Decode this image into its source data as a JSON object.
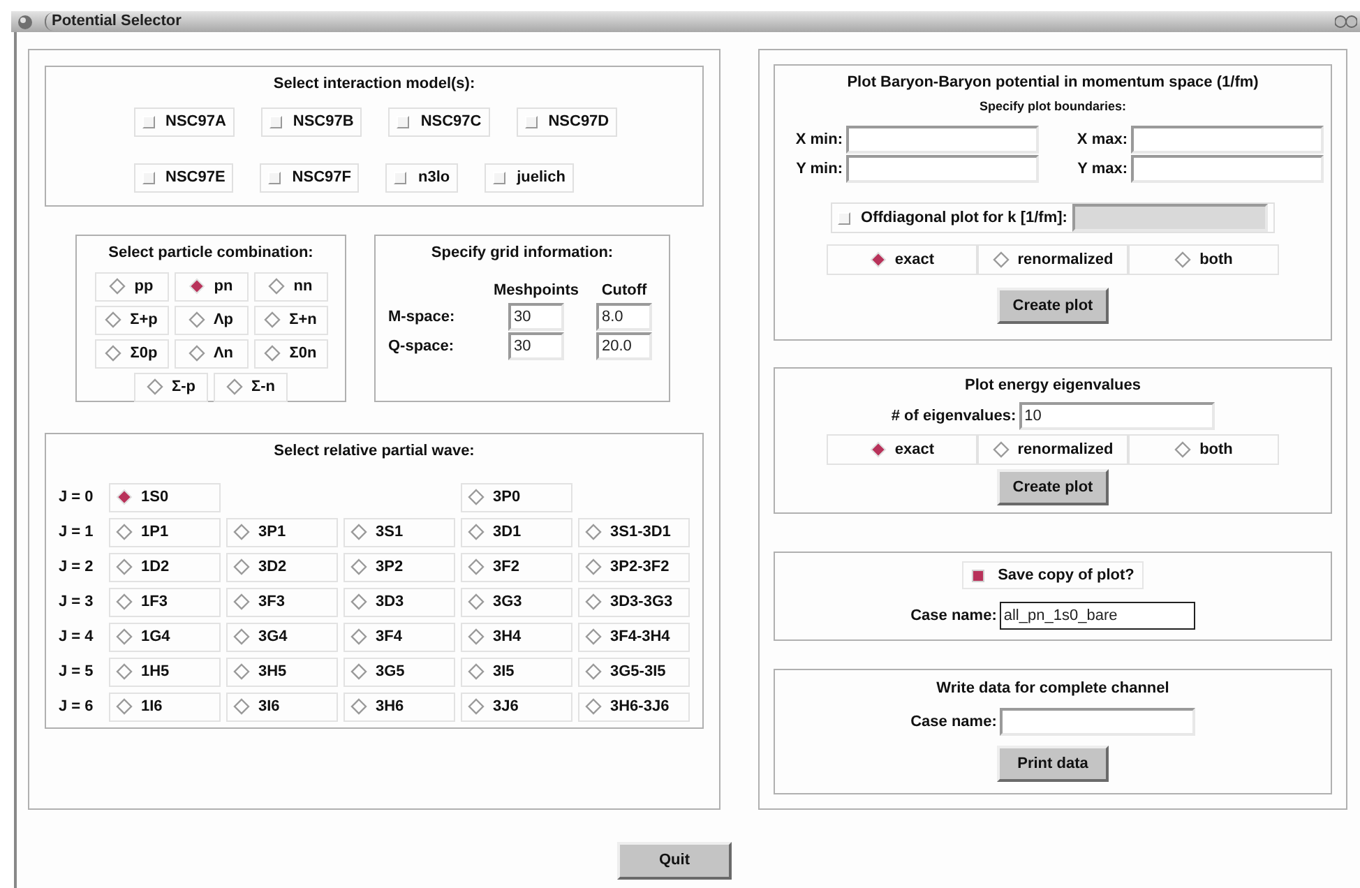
{
  "window": {
    "title": "Potential Selector"
  },
  "models": {
    "title": "Select interaction model(s):",
    "rows": [
      {
        "options": [
          {
            "label": "NSC97A",
            "checked": false
          },
          {
            "label": "NSC97B",
            "checked": false
          },
          {
            "label": "NSC97C",
            "checked": false
          },
          {
            "label": "NSC97D",
            "checked": false
          }
        ]
      },
      {
        "options": [
          {
            "label": "NSC97E",
            "checked": false
          },
          {
            "label": "NSC97F",
            "checked": false
          },
          {
            "label": "n3lo",
            "checked": false
          },
          {
            "label": "juelich",
            "checked": false
          }
        ]
      }
    ]
  },
  "particles": {
    "title": "Select particle combination:",
    "rows": [
      {
        "options": [
          {
            "label": "pp",
            "selected": false
          },
          {
            "label": "pn",
            "selected": true
          },
          {
            "label": "nn",
            "selected": false
          }
        ]
      },
      {
        "options": [
          {
            "label": "Σ+p",
            "selected": false
          },
          {
            "label": "Λp",
            "selected": false
          },
          {
            "label": "Σ+n",
            "selected": false
          }
        ]
      },
      {
        "options": [
          {
            "label": "Σ0p",
            "selected": false
          },
          {
            "label": "Λn",
            "selected": false
          },
          {
            "label": "Σ0n",
            "selected": false
          }
        ]
      },
      {
        "options": [
          {
            "label": "Σ-p",
            "selected": false
          },
          {
            "label": "Σ-n",
            "selected": false
          }
        ]
      }
    ]
  },
  "grid": {
    "title": "Specify grid information:",
    "columns": [
      "Meshpoints",
      "Cutoff"
    ],
    "rows": [
      {
        "label": "M-space:",
        "values": [
          "30",
          "8.0"
        ]
      },
      {
        "label": "Q-space:",
        "values": [
          "30",
          "20.0"
        ]
      }
    ]
  },
  "partial_waves": {
    "title": "Select relative partial wave:",
    "rows": [
      {
        "label": "J = 0",
        "cells": [
          {
            "label": "1S0",
            "selected": true
          },
          null,
          null,
          {
            "label": "3P0",
            "selected": false
          },
          null
        ]
      },
      {
        "label": "J = 1",
        "cells": [
          {
            "label": "1P1",
            "selected": false
          },
          {
            "label": "3P1",
            "selected": false
          },
          {
            "label": "3S1",
            "selected": false
          },
          {
            "label": "3D1",
            "selected": false
          },
          {
            "label": "3S1-3D1",
            "selected": false
          }
        ]
      },
      {
        "label": "J = 2",
        "cells": [
          {
            "label": "1D2",
            "selected": false
          },
          {
            "label": "3D2",
            "selected": false
          },
          {
            "label": "3P2",
            "selected": false
          },
          {
            "label": "3F2",
            "selected": false
          },
          {
            "label": "3P2-3F2",
            "selected": false
          }
        ]
      },
      {
        "label": "J = 3",
        "cells": [
          {
            "label": "1F3",
            "selected": false
          },
          {
            "label": "3F3",
            "selected": false
          },
          {
            "label": "3D3",
            "selected": false
          },
          {
            "label": "3G3",
            "selected": false
          },
          {
            "label": "3D3-3G3",
            "selected": false
          }
        ]
      },
      {
        "label": "J = 4",
        "cells": [
          {
            "label": "1G4",
            "selected": false
          },
          {
            "label": "3G4",
            "selected": false
          },
          {
            "label": "3F4",
            "selected": false
          },
          {
            "label": "3H4",
            "selected": false
          },
          {
            "label": "3F4-3H4",
            "selected": false
          }
        ]
      },
      {
        "label": "J = 5",
        "cells": [
          {
            "label": "1H5",
            "selected": false
          },
          {
            "label": "3H5",
            "selected": false
          },
          {
            "label": "3G5",
            "selected": false
          },
          {
            "label": "3I5",
            "selected": false
          },
          {
            "label": "3G5-3I5",
            "selected": false
          }
        ]
      },
      {
        "label": "J = 6",
        "cells": [
          {
            "label": "1I6",
            "selected": false
          },
          {
            "label": "3I6",
            "selected": false
          },
          {
            "label": "3H6",
            "selected": false
          },
          {
            "label": "3J6",
            "selected": false
          },
          {
            "label": "3H6-3J6",
            "selected": false
          }
        ]
      }
    ]
  },
  "momentum_plot": {
    "title": "Plot Baryon-Baryon potential in momentum space (1/fm)",
    "subtitle": "Specify plot boundaries:",
    "fields": [
      {
        "label": "X min:"
      },
      {
        "label": "X max:"
      },
      {
        "label": "Y min:"
      },
      {
        "label": "Y max:"
      }
    ],
    "offdiagonal": {
      "label": "Offdiagonal plot for k [1/fm]:",
      "checked": false,
      "disabled": true
    },
    "modes": [
      {
        "label": "exact",
        "selected": true
      },
      {
        "label": "renormalized",
        "selected": false
      },
      {
        "label": "both",
        "selected": false
      }
    ],
    "button": "Create plot"
  },
  "eigenvalues": {
    "title": "Plot energy eigenvalues",
    "field": {
      "label": "# of eigenvalues:",
      "value": "10"
    },
    "modes": [
      {
        "label": "exact",
        "selected": true
      },
      {
        "label": "renormalized",
        "selected": false
      },
      {
        "label": "both",
        "selected": false
      }
    ],
    "button": "Create plot"
  },
  "save": {
    "checkbox": {
      "label": "Save copy of plot?",
      "checked": true
    },
    "field": {
      "label": "Case name:",
      "value": "all_pn_1s0_bare",
      "focused": true
    }
  },
  "write": {
    "title": "Write data for complete channel",
    "field": {
      "label": "Case name:"
    },
    "button": "Print data"
  },
  "quit": "Quit"
}
